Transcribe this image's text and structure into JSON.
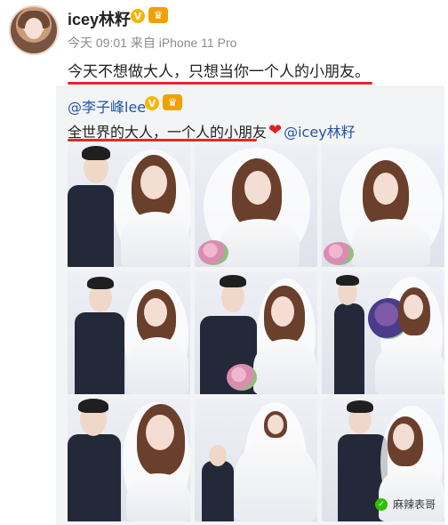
{
  "post": {
    "author_name": "icey林籽",
    "verified_label": "V",
    "crown_label": "♛",
    "meta_line": "今天 09:01 来自 iPhone 11 Pro",
    "status_text": "今天不想做大人，只想当你一个人的小朋友。"
  },
  "quoted": {
    "author_handle": "@李子峰lee",
    "verified_label": "V",
    "crown_label": "♛",
    "text": "全世界的大人，一个人的小朋友",
    "heart_icon": "❤",
    "mention": "@icey林籽"
  },
  "watermark": {
    "label": "麻辣表哥",
    "icon_glyph": "✓"
  },
  "colors": {
    "accent_red": "#e3282b",
    "link_blue": "#2255a4",
    "verified_gold": "#f6b600"
  }
}
